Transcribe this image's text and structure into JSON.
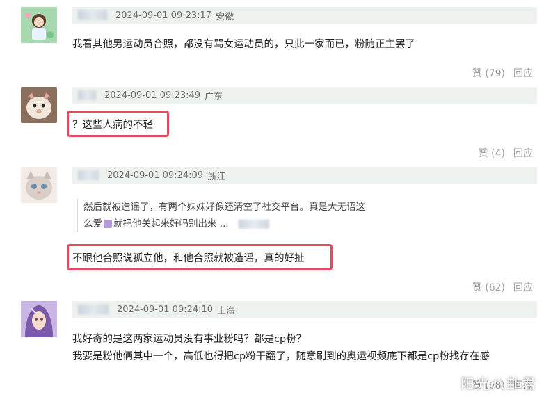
{
  "comments": [
    {
      "time": "2024-09-01 09:23:17",
      "location": "安徽",
      "text": "我看其他男运动员合照，都没有骂女运动员的，只此一家而已，粉随正主罢了",
      "like_label": "赞",
      "like_count": "(79)",
      "reply_label": "回应"
    },
    {
      "time": "2024-09-01 09:23:49",
      "location": "广东",
      "text": "？这些人病的不轻",
      "like_label": "赞",
      "like_count": "(4)",
      "reply_label": "回应"
    },
    {
      "time": "2024-09-01 09:24:09",
      "location": "浙江",
      "quote_line1": "然后就被造谣了，有两个妹妹好像还清空了社交平台。真是大无语这",
      "quote_line2a": "么爱",
      "quote_line2b": "就把他关起来好吗别出来 ...",
      "text": "不跟他合照说孤立他，和他合照就被造谣，真的好扯",
      "like_label": "赞",
      "like_count": "(62)",
      "reply_label": "回应"
    },
    {
      "time": "2024-09-01 09:24:10",
      "location": "上海",
      "text_line1": "我好奇的是这两家运动员没有事业粉吗？都是cp粉？",
      "text_line2": "我要是粉他俩其中一个，高低也得把cp粉干翻了，随意刷到的奥运视频底下都是cp粉找存在感",
      "like_label": "赞",
      "like_count": "(68)",
      "reply_label": "回应"
    }
  ],
  "watermark": "阳光八卦君",
  "colors": {
    "highlight": "#e84a5f",
    "meta_bg": "#eef2ee"
  }
}
